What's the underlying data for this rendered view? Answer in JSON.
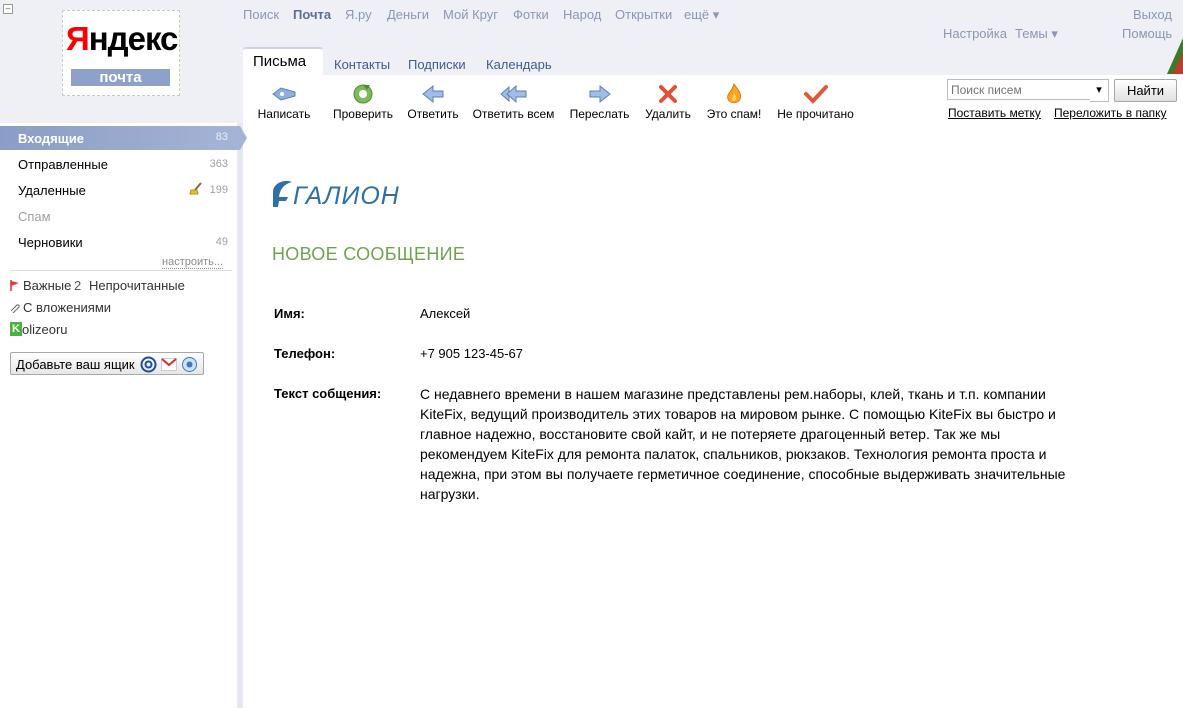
{
  "logo": {
    "word": "Яндекс",
    "sub": "почта"
  },
  "services": [
    "Поиск",
    "Почта",
    "Я.ру",
    "Деньги",
    "Мой Круг",
    "Фотки",
    "Народ",
    "Открытки",
    "ещё ▾"
  ],
  "utility": {
    "settings": "Настройка",
    "themes": "Темы ▾",
    "logout": "Выход",
    "help": "Помощь"
  },
  "tabs": [
    "Письма",
    "Контакты",
    "Подписки",
    "Календарь"
  ],
  "toolbar": [
    "Написать",
    "Проверить",
    "Ответить",
    "Ответить всем",
    "Переслать",
    "Удалить",
    "Это спам!",
    "Не прочитано"
  ],
  "search": {
    "placeholder": "Поиск писем",
    "dropdown": "▾",
    "button": "Найти",
    "set_label": "Поставить метку",
    "move": "Переложить в папку"
  },
  "folders": [
    {
      "name": "Входящие",
      "count": "83"
    },
    {
      "name": "Отправленные",
      "count": "363"
    },
    {
      "name": "Удаленные",
      "count": "199"
    },
    {
      "name": "Спам",
      "count": ""
    },
    {
      "name": "Черновики",
      "count": "49"
    }
  ],
  "folders_setup": "настроить...",
  "labels": {
    "important": "Важные",
    "important_count": "2",
    "unread": "Непрочитанные",
    "attachments": "С вложениями",
    "kolizeoru": "olizeoru",
    "kolizeoru_letter": "K"
  },
  "add_box": "Добавьте ваш ящик",
  "message": {
    "brand": "ГАЛИОН",
    "title": "НОВОЕ СООБЩЕНИЕ",
    "fields": [
      {
        "label": "Имя:",
        "value": "Алексей"
      },
      {
        "label": "Телефон:",
        "value": "+7 905 123-45-67"
      },
      {
        "label": "Текст собщения:",
        "value": "С недавнего времени в нашем магазине представлены рем.наборы, клей, ткань и т.п. компании KiteFix, ведущий производитель этих товаров на мировом рынке. С помощью KiteFix вы быстро и главное надежно, восстановите свой кайт, и не потеряете драгоценный ветер. Так же мы рекомендуем KiteFix для ремонта палаток, спальников, рюкзаков. Технология ремонта проста и надежна, при этом вы получаете герметичное соединение, способные выдерживать значительные нагрузки."
      }
    ]
  },
  "colors": {
    "header_bg": "#eef0f5",
    "inbox_active": "#8b9dc6",
    "link": "#8a97b4",
    "title_green": "#6ca54e",
    "brand_blue": "#2f6fa6",
    "logo_red": "#ff0000"
  }
}
